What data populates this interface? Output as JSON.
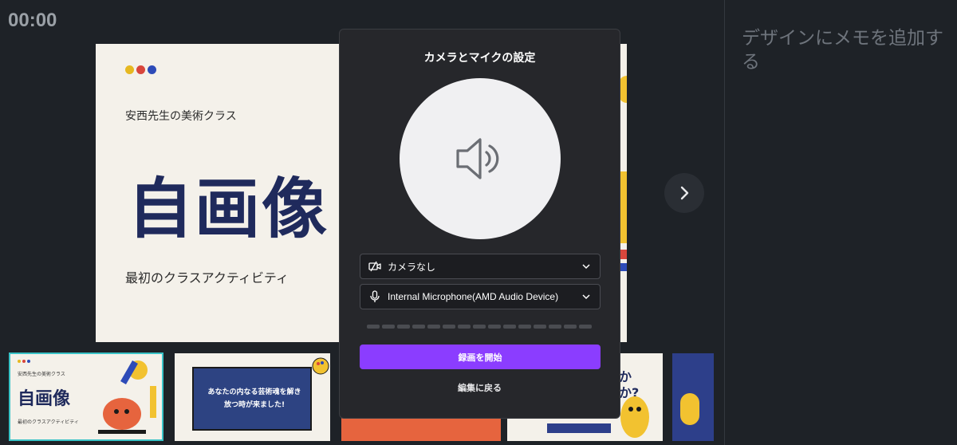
{
  "timer": "00:00",
  "slide": {
    "subtitle": "安西先生の美術クラス",
    "title": "自画像",
    "caption": "最初のクラスアクティビティ",
    "dot_colors": [
      "#e6b820",
      "#d8463c",
      "#2d4bb8"
    ]
  },
  "notes_placeholder": "デザインにメモを追加する",
  "thumbnails": {
    "t1": {
      "subtitle": "安西先生の美術クラス",
      "title": "自画像",
      "caption": "最初のクラスアクティビティ"
    },
    "t2": {
      "board_text": "あなたの内なる芸術魂を解き放つ時が来ました!"
    },
    "t4": {
      "text": "か\nか?"
    }
  },
  "modal": {
    "title": "カメラとマイクの設定",
    "camera_select": {
      "value": "カメラなし",
      "icon": "camera-off-icon"
    },
    "mic_select": {
      "value": "Internal Microphone(AMD Audio Device)",
      "icon": "microphone-icon"
    },
    "meter_segments": 15,
    "start_button": "録画を開始",
    "back_link": "編集に戻る",
    "preview_icon": "speaker-icon"
  },
  "colors": {
    "accent": "#8b3dff",
    "background": "#1e2227",
    "modal_bg": "#26272b",
    "selected_thumb_border": "#39c3c7"
  }
}
